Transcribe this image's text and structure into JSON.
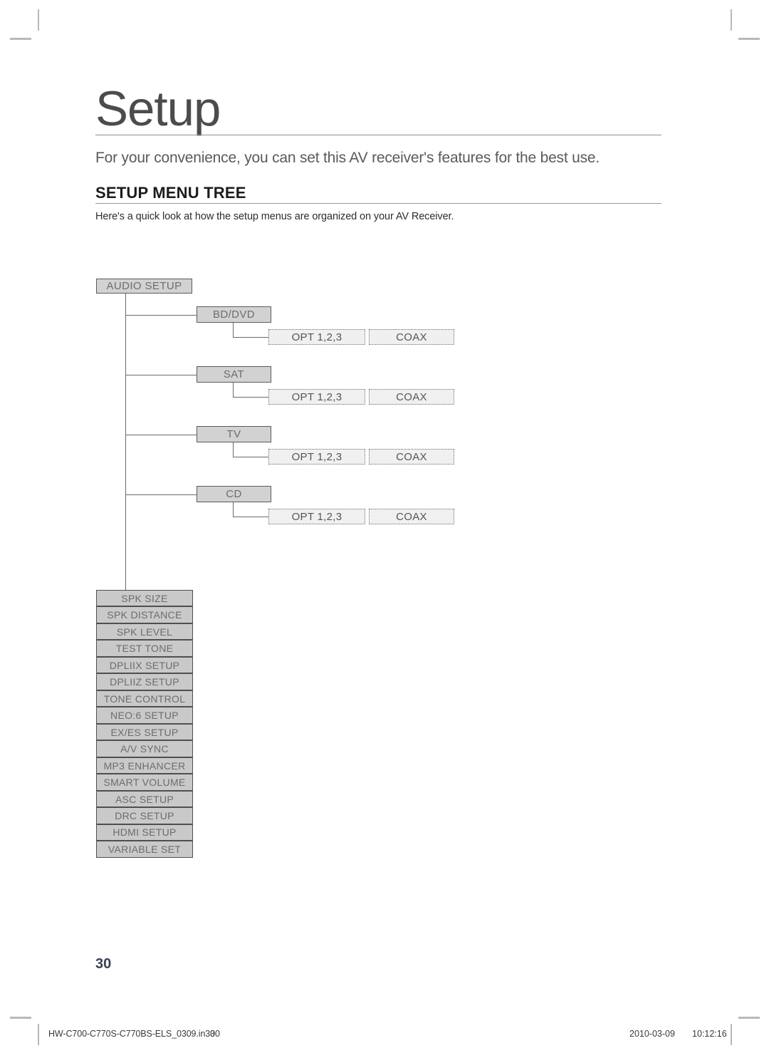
{
  "page": {
    "chapter_title": "Setup",
    "chapter_subtitle": "For your convenience, you can set this AV receiver's features for the best use.",
    "section_heading": "SETUP MENU TREE",
    "section_intro": "Here's a quick look at how the setup menus are organized on your AV Receiver.",
    "page_number": "30"
  },
  "tree": {
    "root": "AUDIO SETUP",
    "sources": [
      {
        "label": "BD/DVD",
        "children": [
          "OPT 1,2,3",
          "COAX"
        ]
      },
      {
        "label": "SAT",
        "children": [
          "OPT 1,2,3",
          "COAX"
        ]
      },
      {
        "label": "TV",
        "children": [
          "OPT 1,2,3",
          "COAX"
        ]
      },
      {
        "label": "CD",
        "children": [
          "OPT 1,2,3",
          "COAX"
        ]
      }
    ],
    "menu_items": [
      "SPK SIZE",
      "SPK DISTANCE",
      "SPK LEVEL",
      "TEST TONE",
      "DPLIIX SETUP",
      "DPLIIZ SETUP",
      "TONE CONTROL",
      "NEO:6 SETUP",
      "EX/ES SETUP",
      "A/V SYNC",
      "MP3 ENHANCER",
      "SMART VOLUME",
      "ASC SETUP",
      "DRC SETUP",
      "HDMI SETUP",
      "VARIABLE SET"
    ]
  },
  "footer": {
    "file_name": "HW-C700-C770S-C770BS-ELS_0309.in30",
    "page_number": "30",
    "date": "2010-03-09",
    "time": "10:12:16"
  },
  "colors": {
    "node_fill": "#d2d2d2",
    "node_border": "#5b5b5b",
    "leaf_fill": "#f0f0f0",
    "menu_fill": "#c9c9c9",
    "page_number": "#3b3f57"
  }
}
